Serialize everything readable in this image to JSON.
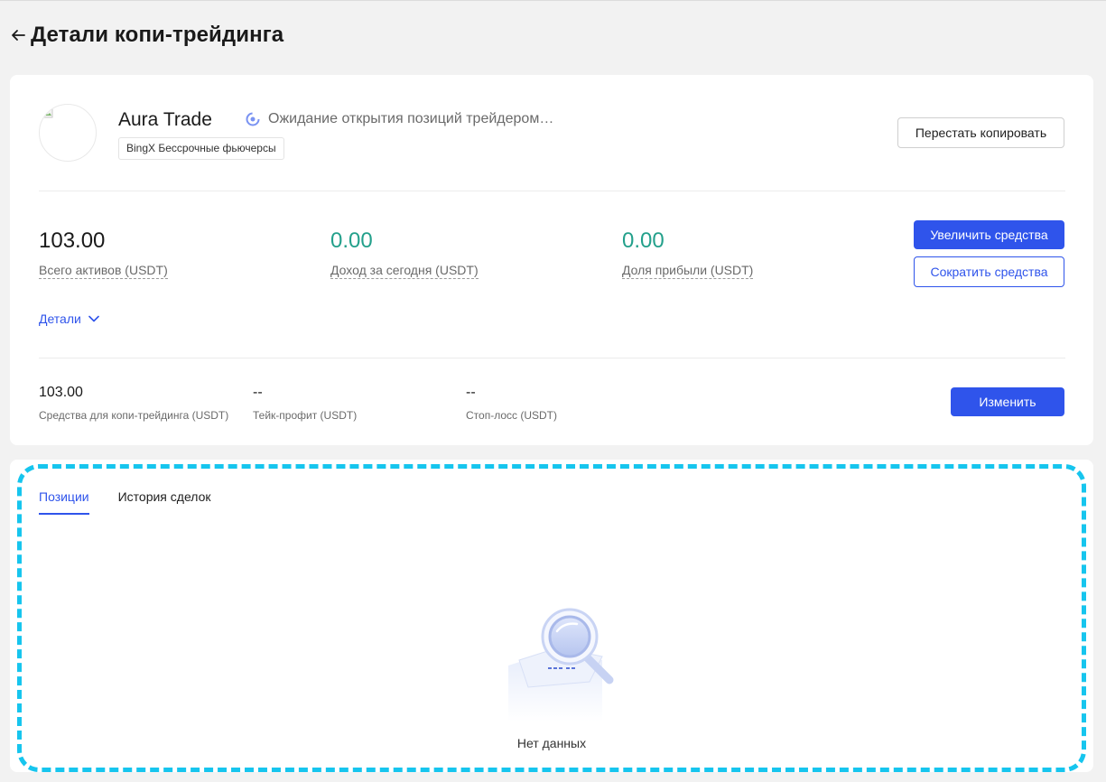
{
  "header": {
    "back_icon": "arrow-left-icon",
    "title": "Детали копи-трейдинга"
  },
  "trader": {
    "name": "Aura Trade",
    "status_icon": "loading-spinner-icon",
    "status_text": "Ожидание открытия позиций трейдером…",
    "exchange_tag": "BingX Бессрочные фьючерсы",
    "stop_copy_label": "Перестать копировать"
  },
  "stats": [
    {
      "value": "103.00",
      "label": "Всего активов (USDT)",
      "color": "#1a1a1a"
    },
    {
      "value": "0.00",
      "label": "Доход за сегодня (USDT)",
      "color": "#23a08b"
    },
    {
      "value": "0.00",
      "label": "Доля прибыли (USDT)",
      "color": "#23a08b"
    }
  ],
  "actions": {
    "increase_label": "Увеличить средства",
    "decrease_label": "Сократить средства",
    "details_label": "Детали",
    "edit_label": "Изменить"
  },
  "settings": [
    {
      "value": "103.00",
      "label": "Средства для копи-трейдинга (USDT)"
    },
    {
      "value": "--",
      "label": "Тейк-профит (USDT)"
    },
    {
      "value": "--",
      "label": "Стоп-лосс (USDT)"
    }
  ],
  "tabs": [
    {
      "label": "Позиции",
      "active": true
    },
    {
      "label": "История сделок",
      "active": false
    }
  ],
  "empty": {
    "text": "Нет данных",
    "icon": "no-data-magnifier-icon"
  },
  "colors": {
    "accent": "#2f54eb",
    "positive": "#23a08b",
    "highlight_outline": "#16c5ee"
  }
}
